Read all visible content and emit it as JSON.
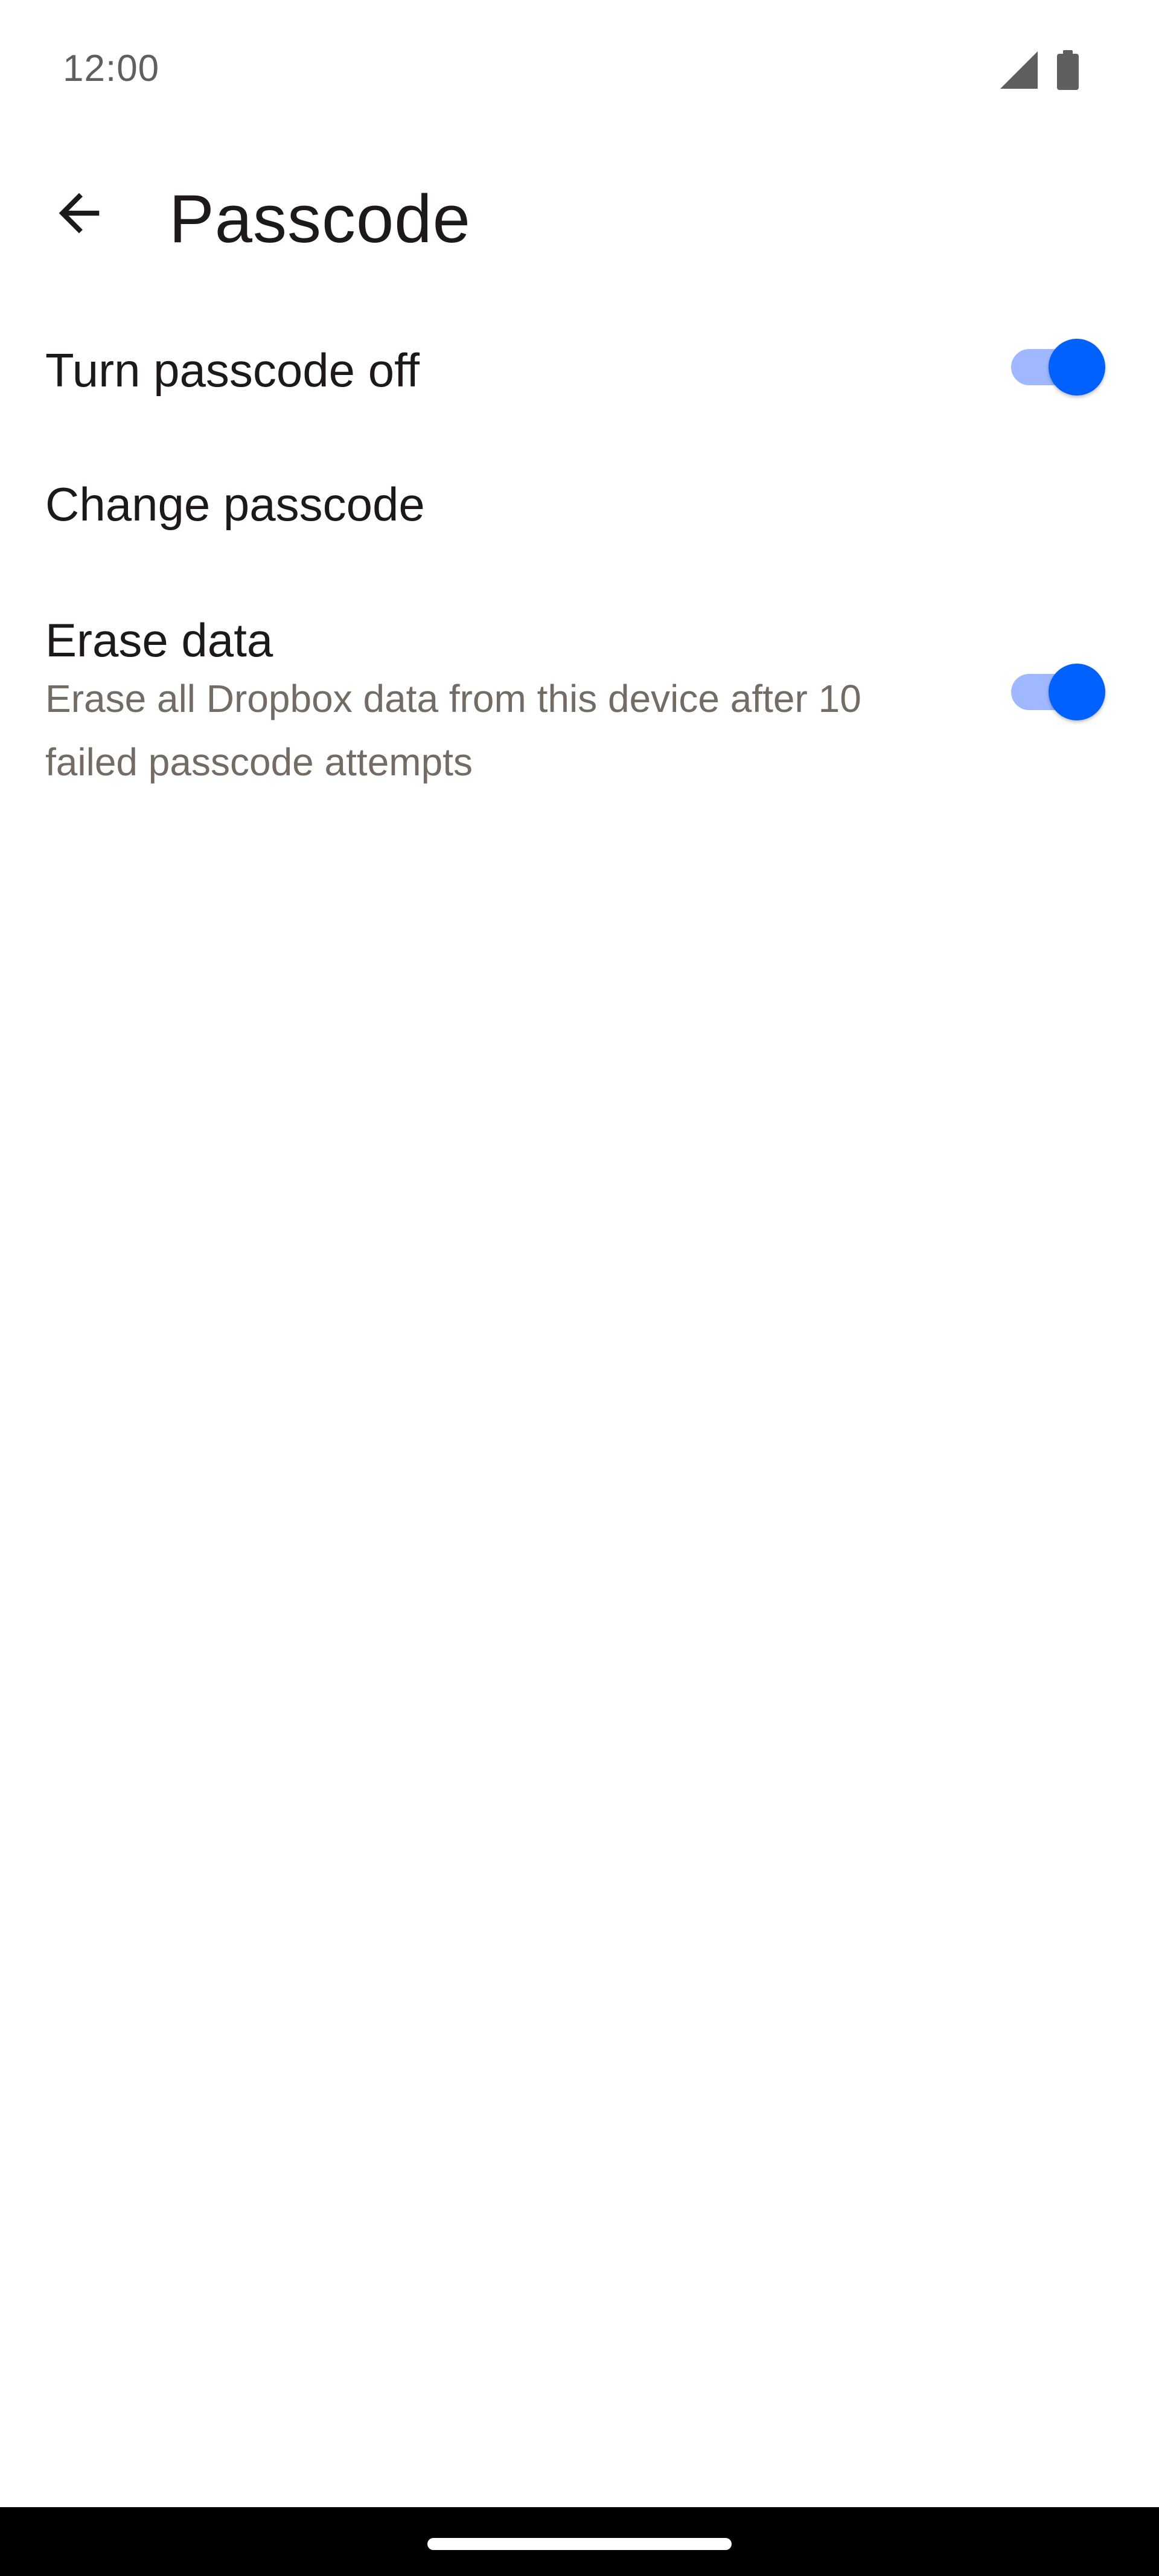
{
  "status_bar": {
    "time": "12:00",
    "icons": [
      "signal-icon",
      "battery-icon"
    ]
  },
  "app_bar": {
    "back_icon": "arrow-left-icon",
    "title": "Passcode"
  },
  "settings": [
    {
      "title": "Turn passcode off",
      "toggle": true,
      "checked": true
    },
    {
      "title": "Change passcode"
    },
    {
      "title": "Erase data",
      "summary": "Erase all Dropbox data from this device after 10 failed passcode attempts",
      "toggle": true,
      "checked": true
    }
  ],
  "colors": {
    "accent": "#0061fe",
    "toggle_track": "#9fb8ff",
    "text_primary": "#1e1919",
    "text_secondary": "#736c64",
    "background": "#ffffff",
    "nav_bar": "#000000"
  }
}
